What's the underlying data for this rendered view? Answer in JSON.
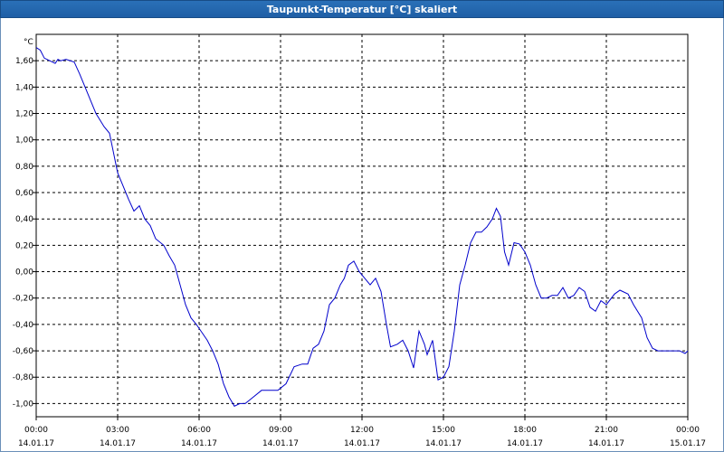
{
  "window": {
    "title": "Taupunkt-Temperatur [°C] skaliert"
  },
  "colors": {
    "titlebar": "#1f5fa6",
    "series": "#0000cc",
    "grid": "#000000"
  },
  "chart_data": {
    "type": "line",
    "title": "Taupunkt-Temperatur [°C] skaliert",
    "ylabel": "°C",
    "xlabel": "",
    "ylim": [
      -1.1,
      1.8
    ],
    "xlim_hours": [
      0,
      24
    ],
    "grid": true,
    "yticks": [
      {
        "v": 1.6,
        "label": "1,60"
      },
      {
        "v": 1.4,
        "label": "1,40"
      },
      {
        "v": 1.2,
        "label": "1,20"
      },
      {
        "v": 1.0,
        "label": "1,00"
      },
      {
        "v": 0.8,
        "label": "0,80"
      },
      {
        "v": 0.6,
        "label": "0,60"
      },
      {
        "v": 0.4,
        "label": "0,40"
      },
      {
        "v": 0.2,
        "label": "0,20"
      },
      {
        "v": 0.0,
        "label": "0,00"
      },
      {
        "v": -0.2,
        "label": "-0,20"
      },
      {
        "v": -0.4,
        "label": "-0,40"
      },
      {
        "v": -0.6,
        "label": "-0,60"
      },
      {
        "v": -0.8,
        "label": "-0,80"
      },
      {
        "v": -1.0,
        "label": "-1,00"
      }
    ],
    "xticks": [
      {
        "h": 0,
        "time": "00:00",
        "date": "14.01.17"
      },
      {
        "h": 3,
        "time": "03:00",
        "date": "14.01.17"
      },
      {
        "h": 6,
        "time": "06:00",
        "date": "14.01.17"
      },
      {
        "h": 9,
        "time": "09:00",
        "date": "14.01.17"
      },
      {
        "h": 12,
        "time": "12:00",
        "date": "14.01.17"
      },
      {
        "h": 15,
        "time": "15:00",
        "date": "14.01.17"
      },
      {
        "h": 18,
        "time": "18:00",
        "date": "14.01.17"
      },
      {
        "h": 21,
        "time": "21:00",
        "date": "14.01.17"
      },
      {
        "h": 24,
        "time": "00:00",
        "date": "15.01.17"
      }
    ],
    "series": [
      {
        "points": [
          [
            0.0,
            1.7
          ],
          [
            0.15,
            1.68
          ],
          [
            0.3,
            1.62
          ],
          [
            0.5,
            1.6
          ],
          [
            0.7,
            1.58
          ],
          [
            0.8,
            1.61
          ],
          [
            0.9,
            1.6
          ],
          [
            1.1,
            1.61
          ],
          [
            1.4,
            1.59
          ],
          [
            1.6,
            1.5
          ],
          [
            1.8,
            1.4
          ],
          [
            2.0,
            1.3
          ],
          [
            2.2,
            1.2
          ],
          [
            2.5,
            1.1
          ],
          [
            2.7,
            1.05
          ],
          [
            2.85,
            0.9
          ],
          [
            3.0,
            0.75
          ],
          [
            3.2,
            0.65
          ],
          [
            3.4,
            0.55
          ],
          [
            3.6,
            0.46
          ],
          [
            3.8,
            0.5
          ],
          [
            4.0,
            0.4
          ],
          [
            4.2,
            0.35
          ],
          [
            4.4,
            0.25
          ],
          [
            4.7,
            0.2
          ],
          [
            4.9,
            0.12
          ],
          [
            5.1,
            0.05
          ],
          [
            5.3,
            -0.1
          ],
          [
            5.5,
            -0.25
          ],
          [
            5.7,
            -0.35
          ],
          [
            5.9,
            -0.4
          ],
          [
            6.1,
            -0.46
          ],
          [
            6.3,
            -0.52
          ],
          [
            6.5,
            -0.6
          ],
          [
            6.7,
            -0.7
          ],
          [
            6.9,
            -0.85
          ],
          [
            7.1,
            -0.95
          ],
          [
            7.3,
            -1.02
          ],
          [
            7.5,
            -1.0
          ],
          [
            7.7,
            -1.0
          ],
          [
            8.0,
            -0.95
          ],
          [
            8.3,
            -0.9
          ],
          [
            8.6,
            -0.9
          ],
          [
            8.9,
            -0.9
          ],
          [
            9.2,
            -0.85
          ],
          [
            9.5,
            -0.72
          ],
          [
            9.8,
            -0.7
          ],
          [
            10.0,
            -0.7
          ],
          [
            10.2,
            -0.58
          ],
          [
            10.4,
            -0.55
          ],
          [
            10.6,
            -0.45
          ],
          [
            10.8,
            -0.25
          ],
          [
            11.0,
            -0.2
          ],
          [
            11.2,
            -0.1
          ],
          [
            11.35,
            -0.05
          ],
          [
            11.5,
            0.05
          ],
          [
            11.7,
            0.08
          ],
          [
            11.9,
            0.0
          ],
          [
            12.1,
            -0.05
          ],
          [
            12.3,
            -0.1
          ],
          [
            12.5,
            -0.05
          ],
          [
            12.7,
            -0.15
          ],
          [
            12.9,
            -0.4
          ],
          [
            13.05,
            -0.57
          ],
          [
            13.3,
            -0.55
          ],
          [
            13.5,
            -0.52
          ],
          [
            13.7,
            -0.6
          ],
          [
            13.9,
            -0.73
          ],
          [
            14.1,
            -0.45
          ],
          [
            14.3,
            -0.55
          ],
          [
            14.4,
            -0.63
          ],
          [
            14.6,
            -0.52
          ],
          [
            14.8,
            -0.82
          ],
          [
            15.0,
            -0.8
          ],
          [
            15.2,
            -0.72
          ],
          [
            15.4,
            -0.45
          ],
          [
            15.6,
            -0.1
          ],
          [
            15.8,
            0.05
          ],
          [
            16.0,
            0.22
          ],
          [
            16.2,
            0.3
          ],
          [
            16.4,
            0.3
          ],
          [
            16.6,
            0.34
          ],
          [
            16.8,
            0.4
          ],
          [
            16.95,
            0.48
          ],
          [
            17.1,
            0.42
          ],
          [
            17.25,
            0.15
          ],
          [
            17.4,
            0.05
          ],
          [
            17.6,
            0.22
          ],
          [
            17.8,
            0.21
          ],
          [
            18.0,
            0.15
          ],
          [
            18.2,
            0.05
          ],
          [
            18.4,
            -0.1
          ],
          [
            18.6,
            -0.2
          ],
          [
            18.8,
            -0.2
          ],
          [
            19.0,
            -0.18
          ],
          [
            19.2,
            -0.18
          ],
          [
            19.4,
            -0.12
          ],
          [
            19.6,
            -0.2
          ],
          [
            19.8,
            -0.18
          ],
          [
            20.0,
            -0.12
          ],
          [
            20.2,
            -0.15
          ],
          [
            20.4,
            -0.27
          ],
          [
            20.6,
            -0.3
          ],
          [
            20.8,
            -0.22
          ],
          [
            21.0,
            -0.25
          ],
          [
            21.3,
            -0.17
          ],
          [
            21.5,
            -0.14
          ],
          [
            21.8,
            -0.17
          ],
          [
            22.0,
            -0.25
          ],
          [
            22.3,
            -0.35
          ],
          [
            22.5,
            -0.5
          ],
          [
            22.7,
            -0.58
          ],
          [
            22.9,
            -0.6
          ],
          [
            23.2,
            -0.6
          ],
          [
            23.5,
            -0.6
          ],
          [
            23.7,
            -0.6
          ],
          [
            23.9,
            -0.62
          ],
          [
            24.0,
            -0.6
          ]
        ]
      }
    ]
  }
}
